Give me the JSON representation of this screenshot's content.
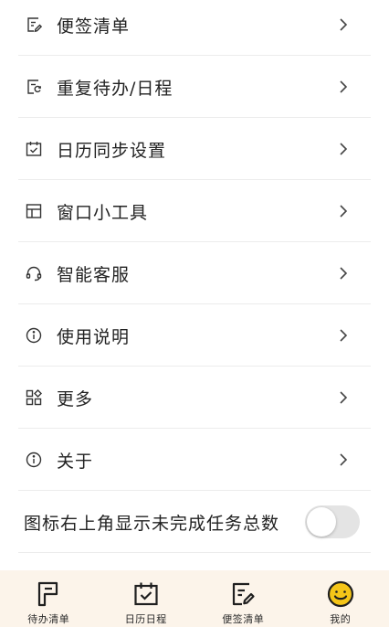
{
  "menu": {
    "items": [
      {
        "label": "便签清单",
        "icon": "note-edit-icon"
      },
      {
        "label": "重复待办/日程",
        "icon": "repeat-note-icon"
      },
      {
        "label": "日历同步设置",
        "icon": "calendar-check-icon"
      },
      {
        "label": "窗口小工具",
        "icon": "widget-layout-icon"
      },
      {
        "label": "智能客服",
        "icon": "headset-icon"
      },
      {
        "label": "使用说明",
        "icon": "info-icon"
      },
      {
        "label": "更多",
        "icon": "grid-more-icon"
      },
      {
        "label": "关于",
        "icon": "info-icon"
      }
    ],
    "badge_toggle": {
      "label": "图标右上角显示未完成任务总数",
      "enabled": false
    }
  },
  "tabbar": {
    "tabs": [
      {
        "label": "待办清单",
        "icon": "todo-flag-icon"
      },
      {
        "label": "日历日程",
        "icon": "calendar-check-icon"
      },
      {
        "label": "便签清单",
        "icon": "note-edit-icon"
      },
      {
        "label": "我的",
        "icon": "smiley-face-icon",
        "active": true
      }
    ]
  },
  "colors": {
    "tabbar_background": "#fcf4ea",
    "active_tab_accent": "#f5c518",
    "toggle_off": "#e4e4e4"
  }
}
